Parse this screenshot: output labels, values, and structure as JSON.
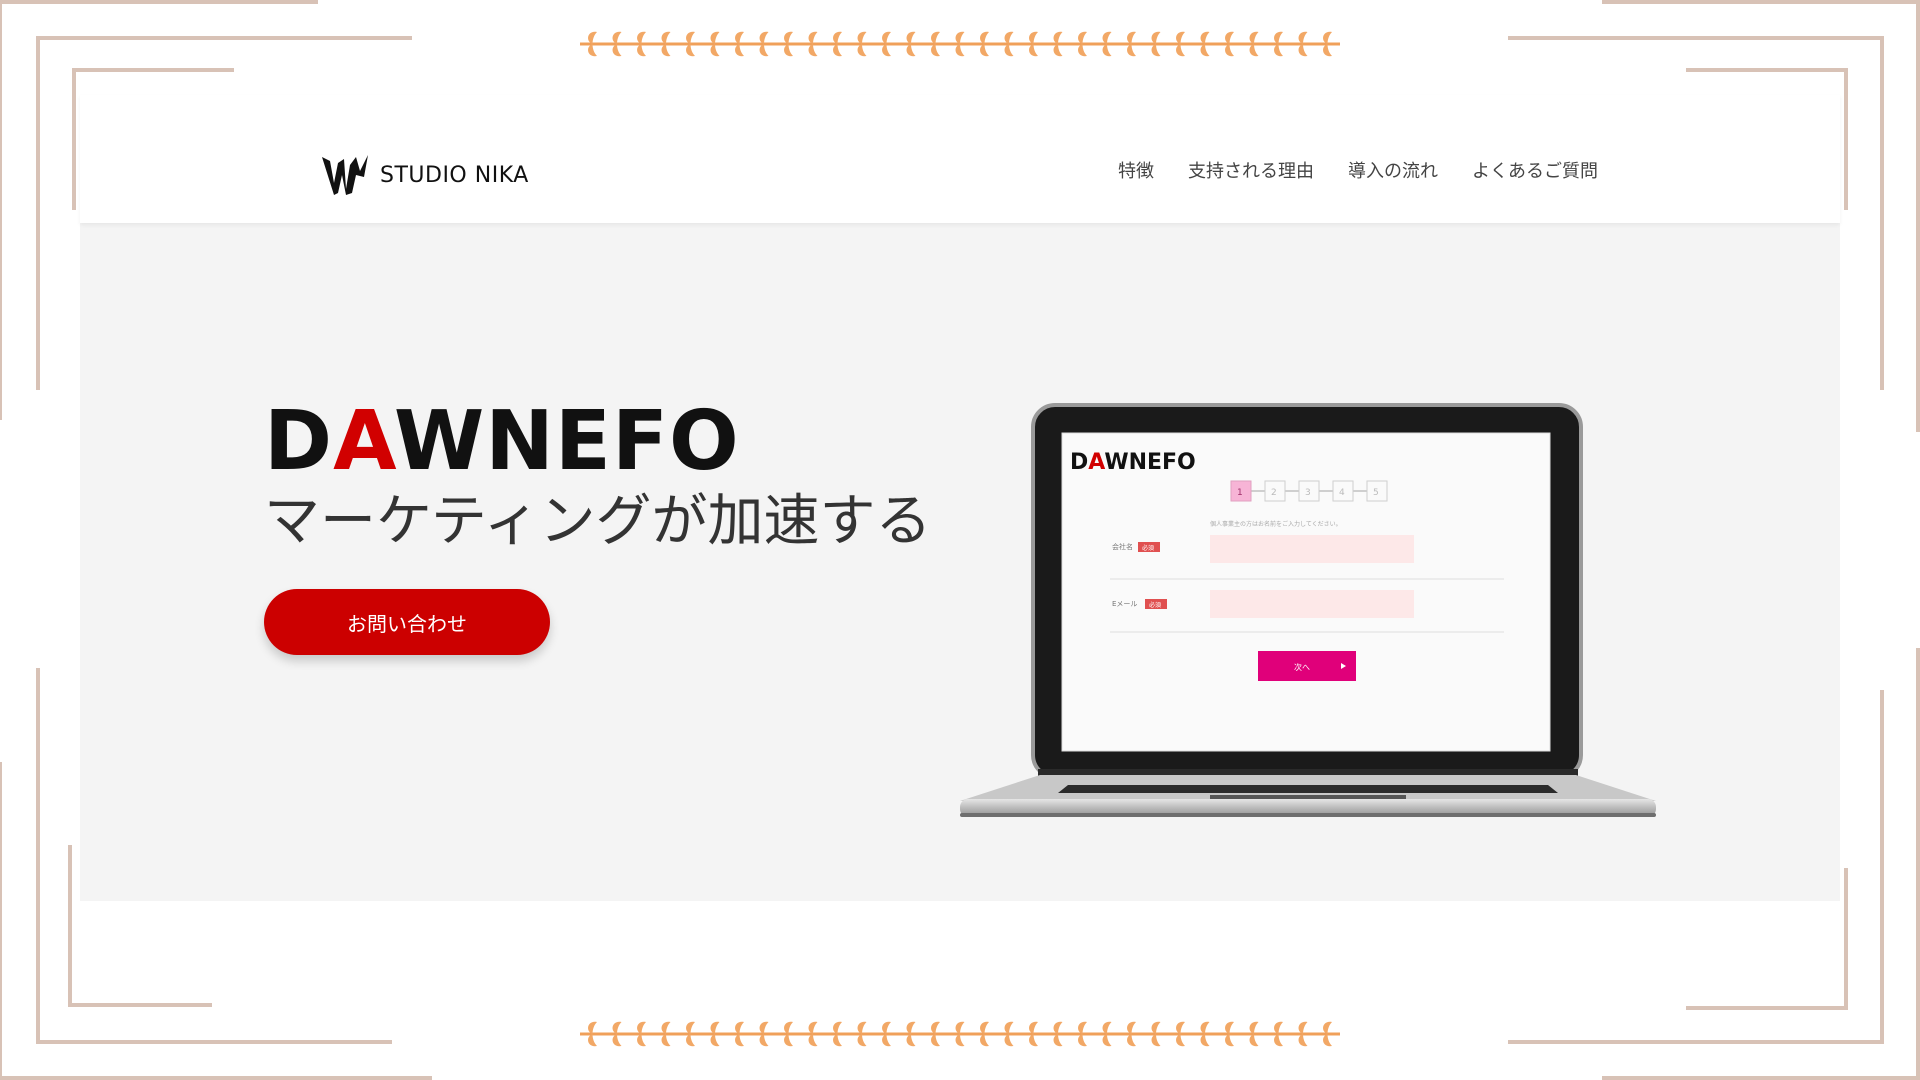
{
  "header": {
    "logo_text": "STUDIO NIKA",
    "nav": [
      "特徴",
      "支持される理由",
      "導入の流れ",
      "よくあるご質問"
    ]
  },
  "hero": {
    "brand_first": "D",
    "brand_accent": "A",
    "brand_rest": "WNEFO",
    "tagline": "マーケティングが加速する",
    "cta_label": "お問い合わせ"
  },
  "laptop_screen": {
    "brand_first": "D",
    "brand_accent": "A",
    "brand_rest": "WNEFO",
    "steps": [
      "1",
      "2",
      "3",
      "4",
      "5"
    ],
    "active_step": 1,
    "hint": "個人事業主の方はお名前をご入力してください。",
    "field1_label": "会社名",
    "field2_label": "Eメール",
    "required_badge": "必須",
    "next_label": "次へ"
  },
  "colors": {
    "accent_red": "#cc0000",
    "brand_red": "#d10000",
    "frame": "#d8c2b6",
    "vine": "#f0a05a",
    "next_button": "#e0007a"
  }
}
